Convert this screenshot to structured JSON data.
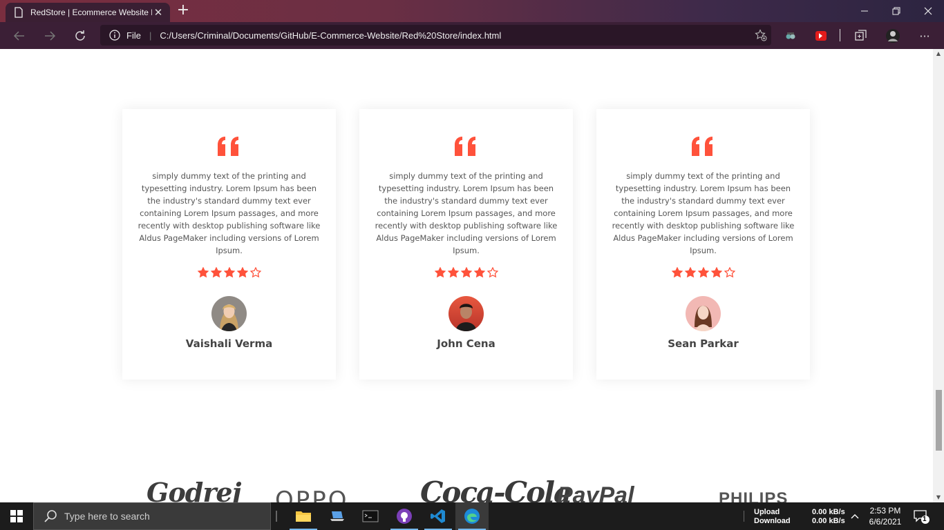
{
  "browser": {
    "tab_title": "RedStore | Ecommerce Website D",
    "tab_close": "✕",
    "new_tab": "+",
    "address_scheme": "File",
    "address_url": "C:/Users/Criminal/Documents/GitHub/E-Commerce-Website/Red%20Store/index.html",
    "controls": {
      "minimize": "—",
      "restore": "❐",
      "close": "✕"
    },
    "more": "···"
  },
  "accent_color": "#ff523b",
  "testimonials": [
    {
      "text": "simply dummy text of the printing and typesetting industry. Lorem Ipsum has been the industry's standard dummy text ever containing Lorem Ipsum passages, and more recently with desktop publishing software like Aldus PageMaker including versions of Lorem Ipsum.",
      "rating": 4,
      "rating_max": 5,
      "name": "Vaishali Verma"
    },
    {
      "text": "simply dummy text of the printing and typesetting industry. Lorem Ipsum has been the industry's standard dummy text ever containing Lorem Ipsum passages, and more recently with desktop publishing software like Aldus PageMaker including versions of Lorem Ipsum.",
      "rating": 4,
      "rating_max": 5,
      "name": "John Cena"
    },
    {
      "text": "simply dummy text of the printing and typesetting industry. Lorem Ipsum has been the industry's standard dummy text ever containing Lorem Ipsum passages, and more recently with desktop publishing software like Aldus PageMaker including versions of Lorem Ipsum.",
      "rating": 4,
      "rating_max": 5,
      "name": "Sean Parkar"
    }
  ],
  "brands": [
    "Godrej",
    "OPPO",
    "Coca-Cola",
    "PayPal",
    "PHILIPS"
  ],
  "taskbar": {
    "search_placeholder": "Type here to search",
    "net_upload_label": "Upload",
    "net_download_label": "Download",
    "net_upload_speed": "0.00 kB/s",
    "net_download_speed": "0.00 kB/s",
    "time": "2:53 PM",
    "date": "6/6/2021",
    "notification_count": "1"
  }
}
